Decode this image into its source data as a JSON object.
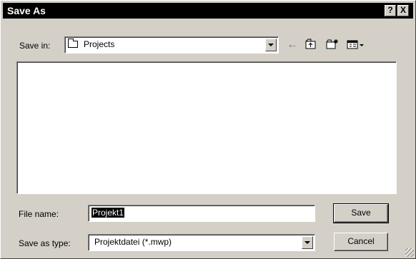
{
  "window": {
    "title": "Save As",
    "help_button": "?",
    "close_button": "X"
  },
  "toolbar": {
    "save_in_label": "Save in:",
    "current_folder": "Projects",
    "icons": [
      "back-arrow-icon",
      "up-folder-icon",
      "new-folder-icon",
      "view-menu-icon"
    ]
  },
  "file_list": {
    "items": []
  },
  "form": {
    "file_name_label": "File name:",
    "file_name_value": "Projekt1",
    "save_as_type_label": "Save as type:",
    "save_as_type_value": "Projektdatei (*.mwp)"
  },
  "buttons": {
    "save": "Save",
    "cancel": "Cancel"
  }
}
